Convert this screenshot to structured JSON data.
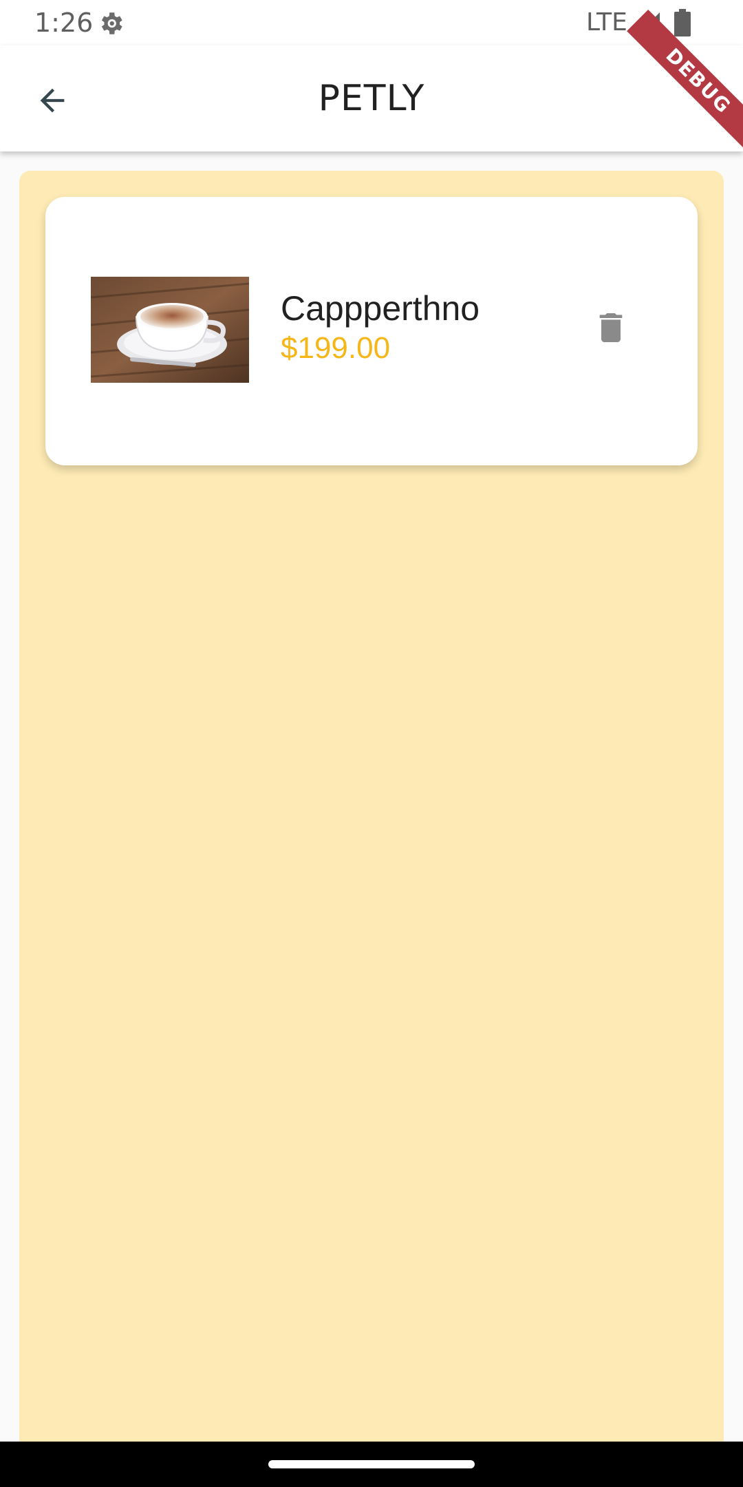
{
  "status_bar": {
    "time": "1:26",
    "network": "LTE",
    "icons": [
      "gear-icon",
      "signal-icon",
      "battery-icon"
    ]
  },
  "app_bar": {
    "title": "PETLY",
    "back_icon": "arrow-back-icon"
  },
  "debug_banner": {
    "label": "DEBUG"
  },
  "cart": {
    "items": [
      {
        "name": "Cappperthno",
        "price": "$199.00",
        "image_icon": "coffee-cup-image",
        "delete_icon": "trash-icon"
      }
    ]
  },
  "colors": {
    "panel_background": "#fdeab4",
    "price": "#f5b617",
    "banner": "#b33a43",
    "icon_gray": "#8a8a8a"
  }
}
